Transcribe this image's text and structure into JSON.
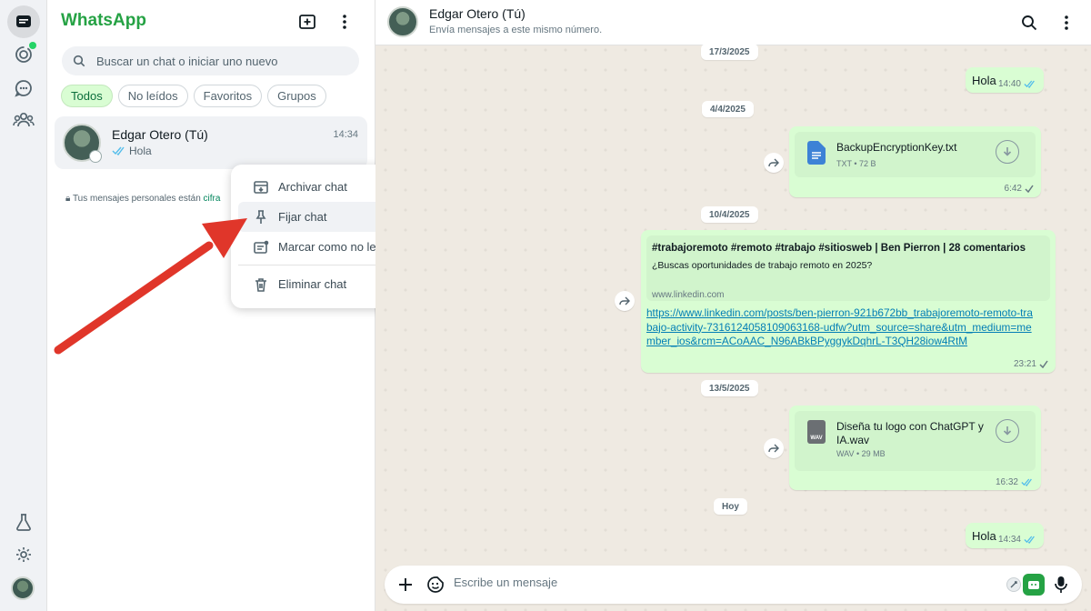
{
  "app": {
    "title": "WhatsApp"
  },
  "colors": {
    "accent": "#25a244",
    "bubble": "#d9fdd3",
    "link": "#027eb5",
    "arrow": "#e0362a",
    "tick_read": "#53bdeb"
  },
  "rail": {
    "icons": [
      "chats-icon",
      "status-icon",
      "channels-icon",
      "communities-icon",
      "lab-icon",
      "settings-icon",
      "profile-avatar"
    ]
  },
  "search": {
    "placeholder": "Buscar un chat o iniciar uno nuevo"
  },
  "filters": [
    {
      "label": "Todos",
      "active": true
    },
    {
      "label": "No leídos"
    },
    {
      "label": "Favoritos"
    },
    {
      "label": "Grupos"
    }
  ],
  "chat_list": [
    {
      "name": "Edgar Otero (Tú)",
      "time": "14:34",
      "last_message": "Hola"
    }
  ],
  "encryption_note": {
    "text": "Tus mensajes personales están",
    "link": "cifra"
  },
  "context_menu": {
    "items": [
      {
        "label": "Archivar chat",
        "icon": "archive-icon"
      },
      {
        "label": "Fijar chat",
        "icon": "pin-icon",
        "hover": true
      },
      {
        "label": "Marcar como no leído",
        "icon": "mark-unread-icon"
      },
      {
        "label": "Eliminar chat",
        "icon": "trash-icon"
      }
    ]
  },
  "conversation": {
    "header": {
      "name": "Edgar Otero (Tú)",
      "subtitle": "Envía mensajes a este mismo número."
    },
    "dates": [
      "17/3/2025",
      "4/4/2025",
      "10/4/2025",
      "13/5/2025",
      "Hoy"
    ],
    "messages": [
      {
        "type": "text",
        "text": "Hola",
        "time": "14:40",
        "status": "read"
      },
      {
        "type": "file",
        "file_name": "BackupEncryptionKey.txt",
        "file_meta": "TXT • 72 B",
        "time": "6:42",
        "status": "sent",
        "icon": "document-icon"
      },
      {
        "type": "link",
        "preview_title": "#trabajoremoto #remoto #trabajo #sitiosweb | Ben Pierron | 28 comentarios",
        "preview_desc": "¿Buscas oportunidades de trabajo remoto en 2025?",
        "preview_url": "www.linkedin.com",
        "url": "https://www.linkedin.com/posts/ben-pierron-921b672bb_trabajoremoto-remoto-trabajo-activity-7316124058109063168-udfw?utm_source=share&utm_medium=member_ios&rcm=ACoAAC_N96ABkBPyggykDqhrL-T3QH28iow4RtM",
        "time": "23:21",
        "status": "sent"
      },
      {
        "type": "file",
        "file_name": "Diseña tu logo con ChatGPT y IA.wav",
        "file_meta": "WAV • 29 MB",
        "file_badge": "WAV",
        "time": "16:32",
        "status": "read",
        "icon": "audio-file-icon"
      },
      {
        "type": "text",
        "text": "Hola",
        "time": "14:34",
        "status": "read"
      }
    ]
  },
  "composer": {
    "placeholder": "Escribe un mensaje"
  }
}
